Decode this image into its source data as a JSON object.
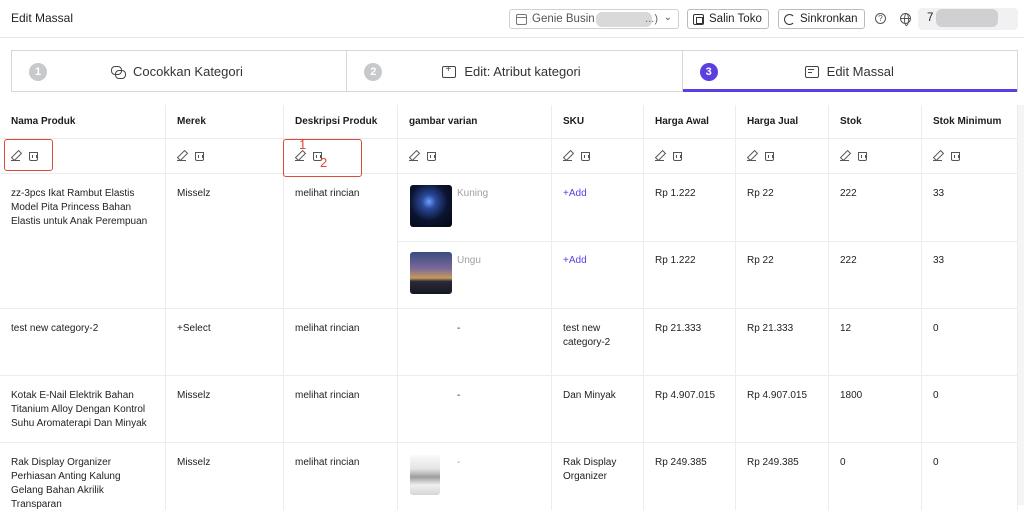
{
  "header": {
    "title": "Edit Massal",
    "store_select": {
      "value": "Genie Busin",
      "suffix": "...)"
    },
    "copy_store_label": "Salin Toko",
    "sync_label": "Sinkronkan",
    "account_label": "7"
  },
  "steps": [
    {
      "num": "1",
      "label": "Cocokkan Kategori",
      "icon": "link-icon",
      "active": false
    },
    {
      "num": "2",
      "label": "Edit: Atribut kategori",
      "icon": "add-attribute-icon",
      "active": false
    },
    {
      "num": "3",
      "label": "Edit Massal",
      "icon": "mass-edit-icon",
      "active": true
    }
  ],
  "table": {
    "columns": [
      "Nama Produk",
      "Merek",
      "Deskripsi Produk",
      "gambar varian",
      "SKU",
      "Harga Awal",
      "Harga Jual",
      "Stok",
      "Stok Minimum"
    ],
    "rows": [
      {
        "name": "zz-3pcs Ikat Rambut Elastis Model Pita Princess Bahan Elastis untuk Anak Perempuan",
        "brand": "Misselz",
        "desc": "melihat rincian",
        "variants": [
          {
            "label": "Kuning",
            "sku": "+Add",
            "price": "Rp 1.222",
            "sale": "Rp 22",
            "stock": "222",
            "min": "33"
          },
          {
            "label": "Ungu",
            "sku": "+Add",
            "price": "Rp 1.222",
            "sale": "Rp 22",
            "stock": "222",
            "min": "33"
          }
        ]
      },
      {
        "name": "test new category-2",
        "brand": "+Select",
        "desc": "melihat rincian",
        "image": "-",
        "sku": "test new category-2",
        "price": "Rp 21.333",
        "sale": "Rp 21.333",
        "stock": "12",
        "min": "0"
      },
      {
        "name": "Kotak E-Nail Elektrik Bahan Titanium Alloy Dengan Kontrol Suhu Aromaterapi Dan Minyak",
        "brand": "Misselz",
        "desc": "melihat rincian",
        "image": "-",
        "sku": "Dan Minyak",
        "price": "Rp 4.907.015",
        "sale": "Rp 4.907.015",
        "stock": "1800",
        "min": "0"
      },
      {
        "name": "Rak Display Organizer Perhiasan Anting Kalung Gelang Bahan Akrilik Transparan",
        "brand": "Misselz",
        "desc": "melihat rincian",
        "image": "-",
        "sku": "Rak Display Organizer",
        "price": "Rp 249.385",
        "sale": "Rp 249.385",
        "stock": "0",
        "min": "0"
      }
    ]
  },
  "annotations": [
    "1",
    "2"
  ],
  "colors": {
    "accent": "#5b3fe0",
    "annotation": "#e0483a"
  }
}
